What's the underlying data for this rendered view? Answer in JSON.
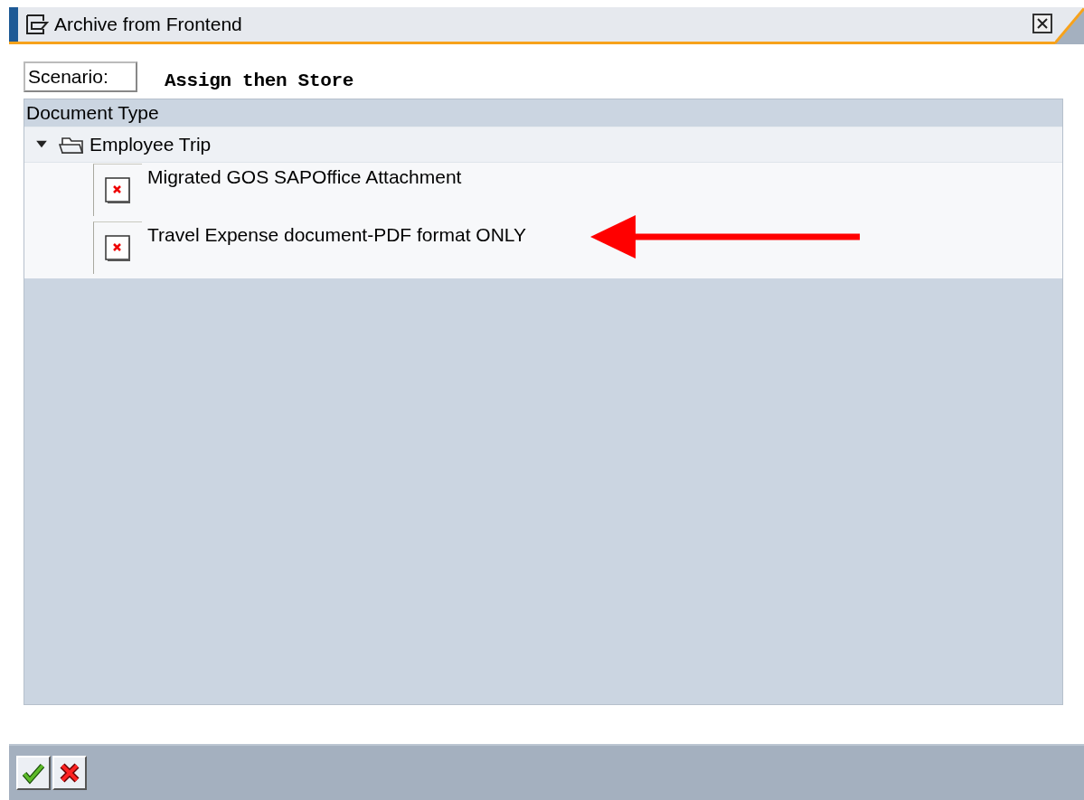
{
  "window": {
    "title": "Archive from Frontend"
  },
  "scenario": {
    "label": "Scenario:",
    "value": "Assign then Store"
  },
  "tree": {
    "column": "Document Type",
    "nodes": [
      {
        "label": "Employee Trip",
        "expanded": true,
        "children": [
          {
            "label": "Migrated GOS SAPOffice Attachment"
          },
          {
            "label": "Travel Expense document-PDF format ONLY"
          }
        ]
      }
    ]
  },
  "buttons": [
    {
      "kind": "confirm"
    },
    {
      "kind": "cancel"
    }
  ]
}
